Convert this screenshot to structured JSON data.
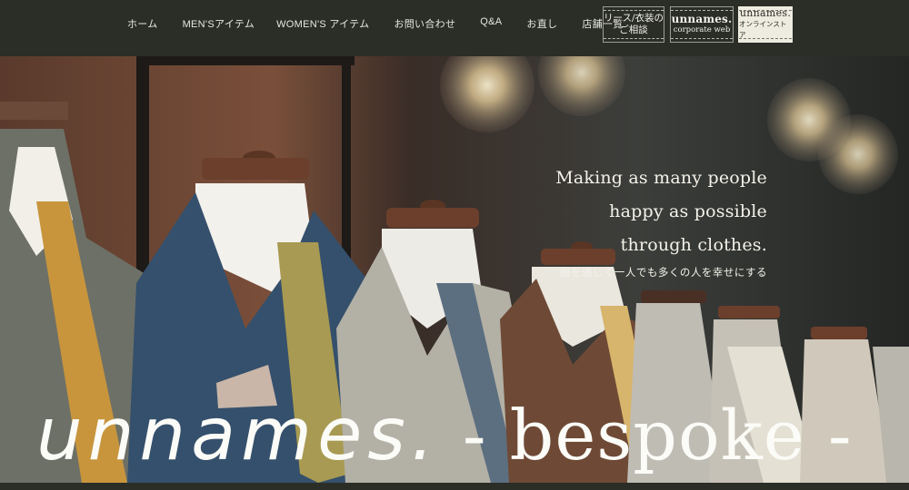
{
  "nav": {
    "items": [
      {
        "label": "ホーム"
      },
      {
        "label": "MEN'Sアイテム"
      },
      {
        "label": "WOMEN'S アイテム"
      },
      {
        "label": "お問い合わせ"
      },
      {
        "label": "Q&A"
      },
      {
        "label": "お直し"
      },
      {
        "label": "店舗一覧"
      }
    ]
  },
  "header_buttons": {
    "consult": {
      "line1": "リース/衣装の",
      "line2": "ご相談"
    },
    "corporate": {
      "line1": "unnames.",
      "line2": "corporate web"
    },
    "store": {
      "line1": "unnames.",
      "line2": "オンラインストア"
    }
  },
  "hero": {
    "tagline_lines": [
      "Making as many people",
      "happy as possible",
      "through clothes."
    ],
    "tagline_jp": "服を通じて一人でも多くの人を幸せにする",
    "logo_word": "unnames.",
    "logo_suffix": "- bespoke -",
    "image_description_icon": "suits-on-mannequins"
  },
  "colors": {
    "header_bg": "#2b2d27",
    "text_light": "#f4f2ea",
    "store_button_bg": "#eeebe0"
  }
}
